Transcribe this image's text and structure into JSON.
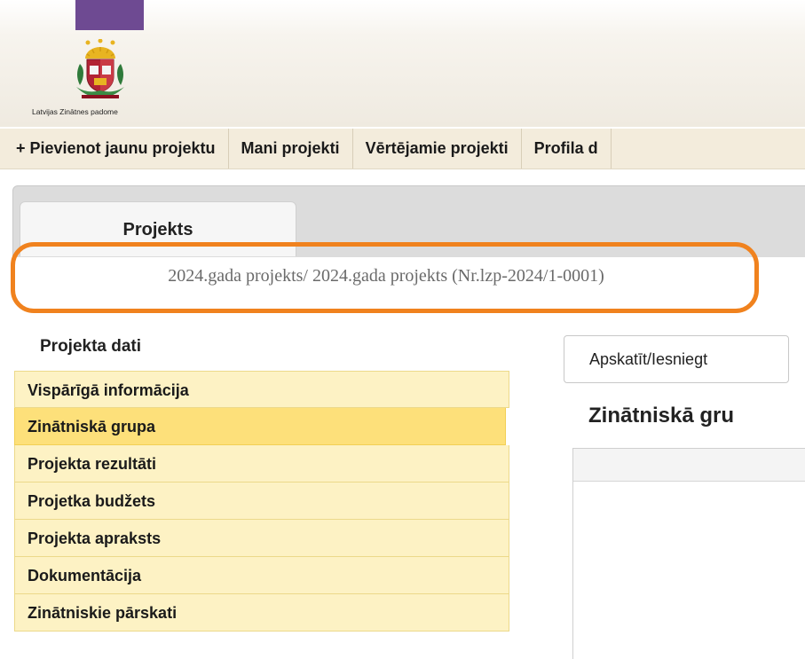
{
  "logo": {
    "caption": "Latvijas Zinātnes padome",
    "icon": "latvian-coat-of-arms-icon"
  },
  "nav": {
    "items": [
      {
        "label": "+ Pievienot jaunu projektu"
      },
      {
        "label": "Mani projekti"
      },
      {
        "label": "Vērtējamie projekti"
      },
      {
        "label": "Profila d"
      }
    ]
  },
  "tabs": {
    "active_label": "Projekts"
  },
  "breadcrumb": {
    "text": "2024.gada projekts/ 2024.gada projekts (Nr.lzp-2024/1-0001)"
  },
  "sidebar": {
    "heading": "Projekta dati",
    "items": [
      {
        "label": "Vispārīgā informācija",
        "active": false
      },
      {
        "label": "Zinātniskā grupa",
        "active": true
      },
      {
        "label": "Projekta rezultāti",
        "active": false
      },
      {
        "label": "Projetka budžets",
        "active": false
      },
      {
        "label": "Projekta apraksts",
        "active": false
      },
      {
        "label": "Dokumentācija",
        "active": false
      },
      {
        "label": "Zinātniskie pārskati",
        "active": false
      }
    ]
  },
  "main": {
    "view_button_label": "Apskatīt/Iesniegt",
    "section_title": "Zinātniskā gru"
  },
  "colors": {
    "brand_purple": "#6e4a92",
    "highlight_orange": "#f0821e",
    "menu_bg": "#fdf2c4",
    "menu_active_bg": "#fde07a"
  }
}
